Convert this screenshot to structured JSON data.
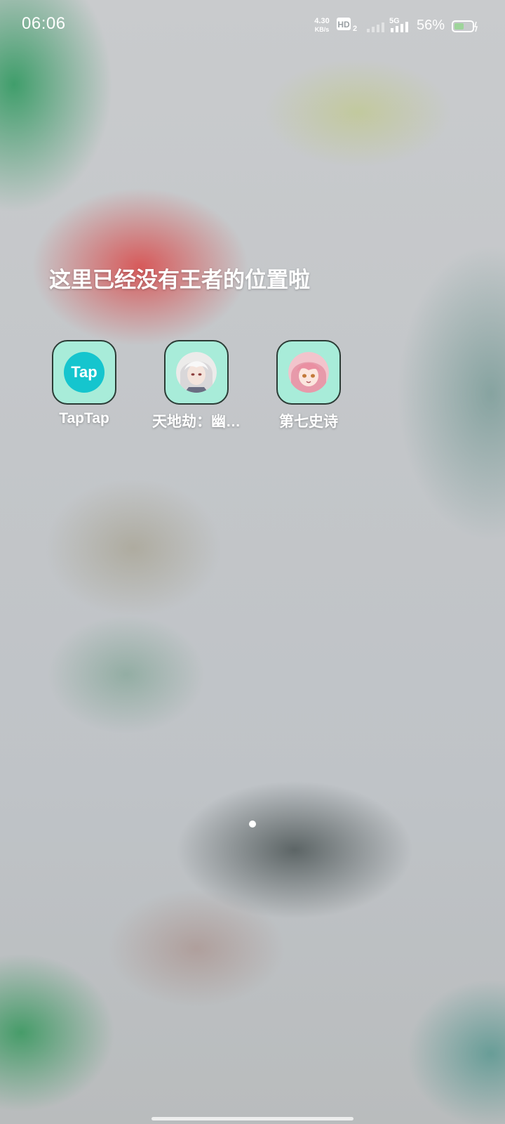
{
  "status_bar": {
    "time": "06:06",
    "net_speed_value": "4.30",
    "net_speed_unit": "KB/s",
    "hd_badge": "HD",
    "hd_sub": "2",
    "network_type": "5G",
    "battery_percent": "56%",
    "battery_level": 0.56,
    "icons": [
      "hd-icon",
      "signal-strength-icon",
      "5g-signal-icon",
      "battery-icon"
    ]
  },
  "folder": {
    "title": "这里已经没有王者的位置啦",
    "apps": [
      {
        "label": "TapTap",
        "icon_text": "Tap",
        "icon": "taptap-icon"
      },
      {
        "label": "天地劫：幽…",
        "icon": "tiandijie-avatar-icon"
      },
      {
        "label": "第七史诗",
        "icon": "epic-seven-avatar-icon"
      }
    ],
    "tile_color": "#a8ecd9",
    "taptap_color": "#15c5ce"
  },
  "pager": {
    "pages": 1,
    "current": 1
  }
}
